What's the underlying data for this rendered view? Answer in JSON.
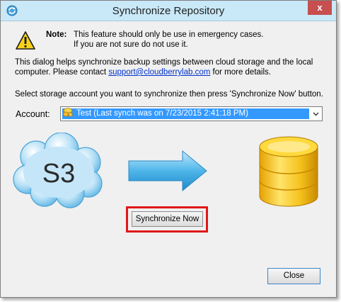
{
  "window": {
    "title": "Synchronize Repository",
    "close_glyph": "x",
    "icon": "sync-app-icon"
  },
  "note": {
    "label": "Note:",
    "line1": "This feature should only be use in emergency cases.",
    "line2": "If you are not sure do not use it.",
    "icon": "warning-icon"
  },
  "info": {
    "line1": "This dialog helps synchronize backup settings between cloud storage and the local",
    "line2_prefix": "computer. Please contact ",
    "support_email": "support@cloudberrylab.com",
    "line2_suffix": " for more details.",
    "instruction": "Select storage account you want to synchronize then press 'Synchronize Now' button."
  },
  "account": {
    "label": "Account:",
    "selected_value": "Test (Last synch was on 7/23/2015 2:41:18 PM)",
    "icon": "storage-account-icon"
  },
  "graphic": {
    "cloud_label": "S3",
    "arrow": "right-arrow",
    "database": "database-icon"
  },
  "buttons": {
    "synchronize_now": "Synchronize Now",
    "close": "Close"
  },
  "colors": {
    "titlebar": "#c9e8f8",
    "selection": "#3399ff",
    "highlight": "#e01818",
    "link": "#0033cc"
  }
}
